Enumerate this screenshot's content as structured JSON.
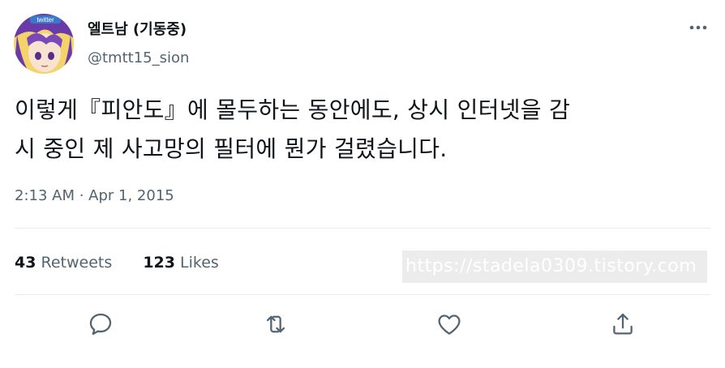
{
  "user": {
    "display_name": "엘트남 (기동중)",
    "handle": "@tmtt15_sion",
    "avatar_text": "twitter"
  },
  "tweet": {
    "text": "이렇게『피안도』에 몰두하는 동안에도, 상시 인터넷을 감\n시 중인 제 사고망의 필터에 뭔가 걸렸습니다.",
    "timestamp": "2:13 AM · Apr 1, 2015"
  },
  "stats": {
    "retweets_count": "43",
    "retweets_label": "Retweets",
    "likes_count": "123",
    "likes_label": "Likes"
  },
  "watermark": "https://stadela0309.tistory.com",
  "icons": {
    "more": "more-icon",
    "reply": "reply-icon",
    "retweet": "retweet-icon",
    "like": "like-icon",
    "share": "share-icon"
  },
  "colors": {
    "text": "#0f1419",
    "secondary": "#536471",
    "divider": "#e6ecf0",
    "icon": "#536471"
  }
}
